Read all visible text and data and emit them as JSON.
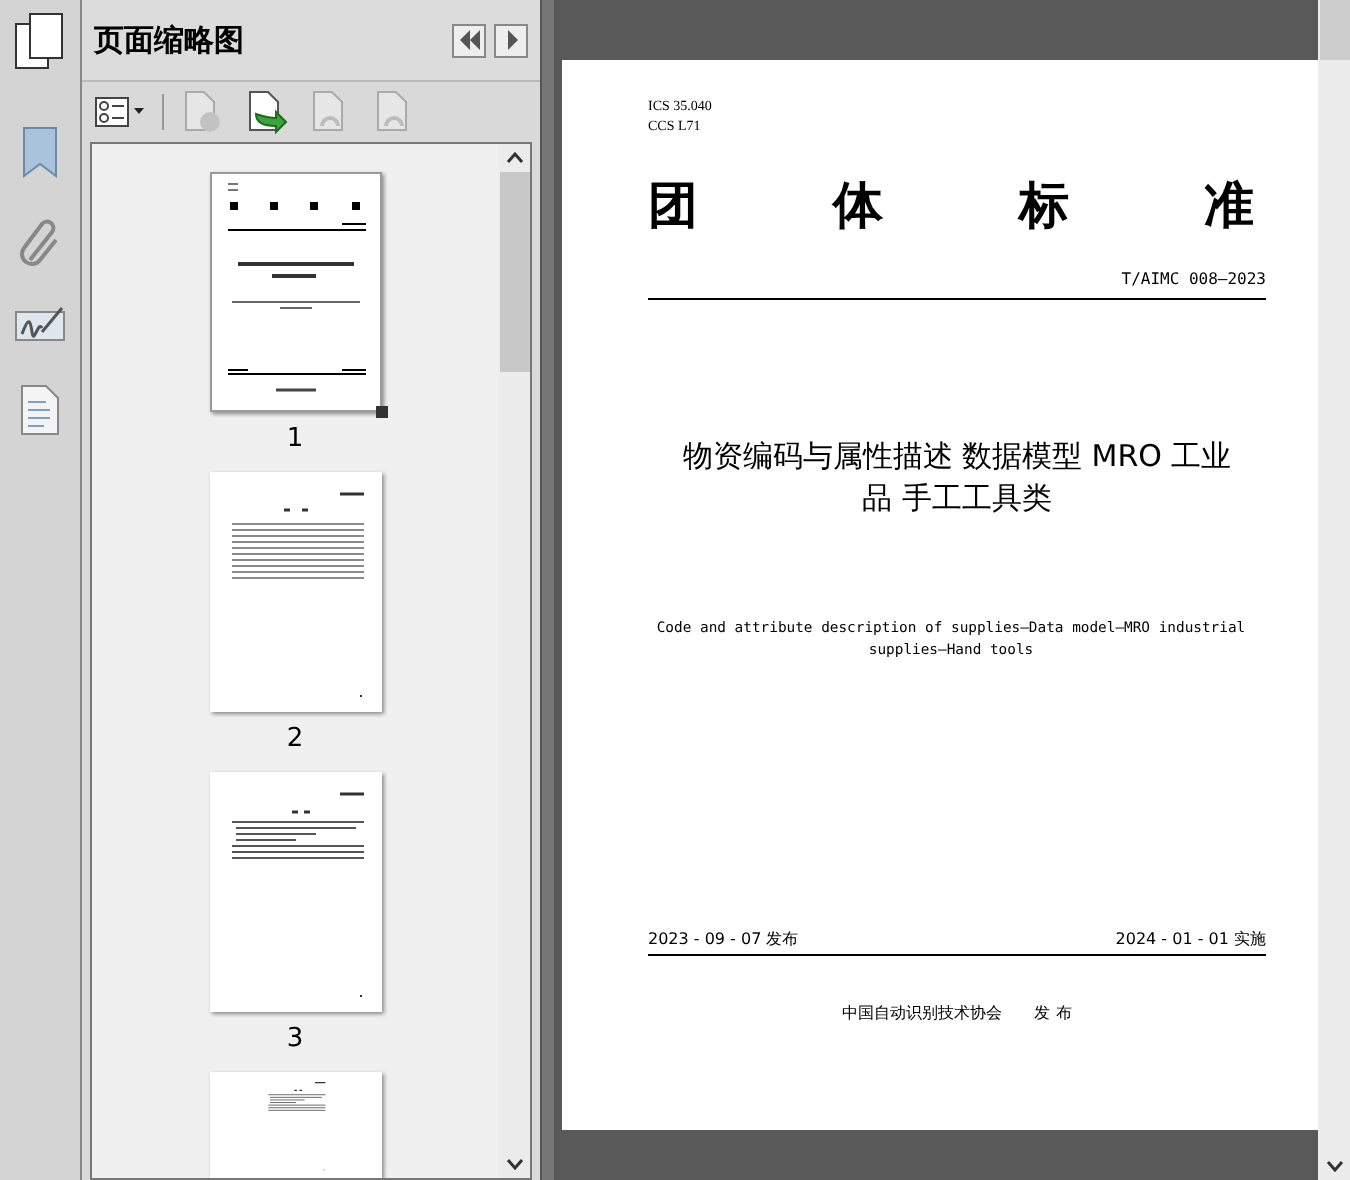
{
  "panel": {
    "title": "页面缩略图"
  },
  "toolbar": [
    {
      "kind": "options",
      "disabled": false
    },
    {
      "kind": "delete",
      "disabled": true
    },
    {
      "kind": "insert",
      "disabled": false
    },
    {
      "kind": "undo",
      "disabled": true
    },
    {
      "kind": "redo",
      "disabled": true
    }
  ],
  "thumbnails": [
    {
      "page": "1",
      "selected": true,
      "kind": "cover"
    },
    {
      "page": "2",
      "selected": false,
      "kind": "contents"
    },
    {
      "page": "3",
      "selected": false,
      "kind": "text"
    },
    {
      "selected": false,
      "kind": "text"
    }
  ],
  "document": {
    "ics": "ICS 35.040",
    "ccs": "CCS L71",
    "heading": [
      "团",
      "体",
      "标",
      "准"
    ],
    "code": "T/AIMC 008—2023",
    "title_lines": [
      "物资编码与属性描述 数据模型 MRO 工业",
      "品 手工工具类"
    ],
    "english_title_lines": [
      "Code and attribute description of supplies—Data model—MRO industrial",
      "supplies—Hand tools"
    ],
    "issue_date": "2023 - 09 - 07 发布",
    "effective_date": "2024 - 01 - 01 实施",
    "publisher": "中国自动识别技术协会",
    "publish_word": "发 布"
  }
}
